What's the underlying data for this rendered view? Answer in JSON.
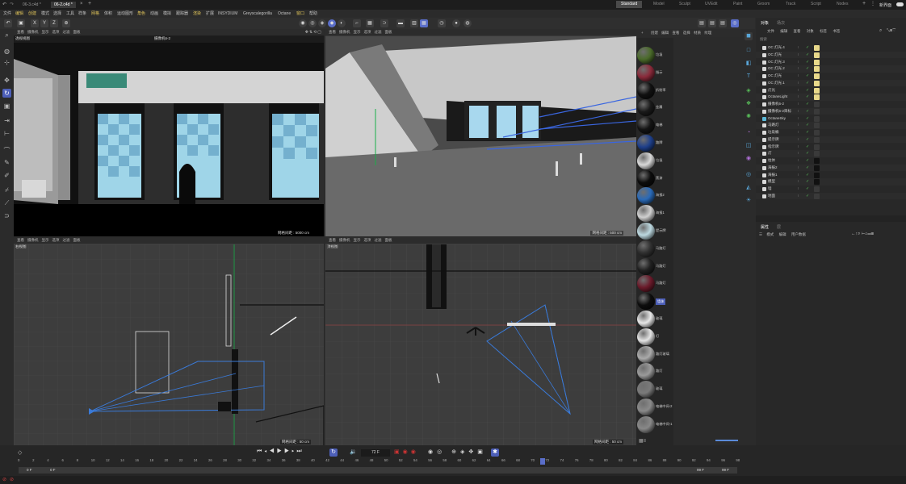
{
  "titlebar": {
    "tabs": [
      {
        "label": "06-3.c4d *"
      },
      {
        "label": "06-2.c4d *"
      }
    ],
    "layouts": [
      "Standard",
      "Model",
      "Sculpt",
      "UVEdit",
      "Paint",
      "Groom",
      "Track",
      "Script",
      "Nodes"
    ],
    "new_layout": "新界面"
  },
  "menubar": {
    "items": [
      "文件",
      "编辑",
      "创建",
      "模式",
      "选择",
      "工具",
      "样条",
      "网格",
      "体积",
      "运动图形",
      "角色",
      "动画",
      "模拟",
      "跟踪器",
      "渲染",
      "扩展",
      "INSYDIUM",
      "Greyscalegorilla",
      "Octane",
      "窗口",
      "帮助"
    ]
  },
  "toolbar": {
    "axis_x": "X",
    "axis_y": "Y",
    "axis_z": "Z"
  },
  "viewports": {
    "menu": [
      "查看",
      "摄像机",
      "显示",
      "选项",
      "过滤",
      "面板"
    ],
    "tl": {
      "label": "透视视图",
      "camera": "摄像机6-2",
      "footer": "网格间距 : 5000 cm"
    },
    "tr": {
      "label": "透视视图",
      "footer": "网格间距 : 500 cm"
    },
    "bl": {
      "label": "右视图",
      "footer": "网格间距 : 50 cm"
    },
    "br": {
      "label": "顶视图",
      "footer": "网格间距 : 50 cm"
    }
  },
  "materials": {
    "menu": [
      "+",
      "创建",
      "编辑",
      "查看",
      "选择",
      "材质",
      "纹理"
    ],
    "items": [
      {
        "label": "垃圾",
        "color": "#4a6a2a"
      },
      {
        "label": "指示",
        "color": "#8a2a3a"
      },
      {
        "label": "折射率",
        "color": "#111111"
      },
      {
        "label": "金属",
        "color": "#1a1a1a"
      },
      {
        "label": "电梯",
        "color": "#141414"
      },
      {
        "label": "路牌",
        "color": "#1e3f8a"
      },
      {
        "label": "垃圾",
        "color": "#d8d8d8"
      },
      {
        "label": "黑漆",
        "color": "#0c0c0c"
      },
      {
        "label": "海报2",
        "color": "#2a6ab8"
      },
      {
        "label": "海报1",
        "color": "#d0d0d0"
      },
      {
        "label": "提示牌",
        "color": "#bcd8e0"
      },
      {
        "label": "马路灯",
        "color": "#303030"
      },
      {
        "label": "马路灯",
        "color": "#202020"
      },
      {
        "label": "马路灯",
        "color": "#6a1a2a"
      },
      {
        "label": "墙体",
        "color": "#0e0e0e"
      },
      {
        "label": "玻璃",
        "color": "#e8e8e8"
      },
      {
        "label": "灯",
        "color": "#e4e4e4"
      },
      {
        "label": "路灯玻璃",
        "color": "#aaaaaa"
      },
      {
        "label": "路灯",
        "color": "#9a9a9a"
      },
      {
        "label": "玻璃",
        "color": "#7a7a7a"
      },
      {
        "label": "电梯中间-2",
        "color": "#8a8a8a"
      },
      {
        "label": "电梯中间-1",
        "color": "#888888"
      }
    ]
  },
  "objects_panel": {
    "tabs": [
      "对象",
      "场次"
    ],
    "menu": [
      "文件",
      "编辑",
      "查看",
      "对象",
      "标签",
      "书签"
    ],
    "search_placeholder": "搜索",
    "items": [
      {
        "name": "OC 灯光.4",
        "color": "#d8d8d8"
      },
      {
        "name": "OC 灯光",
        "color": "#d8d8d8"
      },
      {
        "name": "OC 灯光.3",
        "color": "#d8d8d8"
      },
      {
        "name": "OC 灯光.2",
        "color": "#d8d8d8"
      },
      {
        "name": "OC 灯光",
        "color": "#d8d8d8"
      },
      {
        "name": "OC 灯光.1",
        "color": "#d8d8d8"
      },
      {
        "name": "灯光",
        "color": "#d8d8d8"
      },
      {
        "name": "OctaneLight",
        "color": "#d8d8d8"
      },
      {
        "name": "摄像机6-2",
        "color": "#d8d8d8"
      },
      {
        "name": "摄像机6-2目标",
        "color": "#d8d8d8"
      },
      {
        "name": "OctaneSky",
        "color": "#5ab8d8"
      },
      {
        "name": "马路灯",
        "color": "#d8d8d8"
      },
      {
        "name": "垃圾桶",
        "color": "#d8d8d8"
      },
      {
        "name": "提示牌",
        "color": "#d8d8d8"
      },
      {
        "name": "指示牌",
        "color": "#d8d8d8"
      },
      {
        "name": "灯",
        "color": "#d8d8d8"
      },
      {
        "name": "柱体",
        "color": "#d8d8d8"
      },
      {
        "name": "海报2",
        "color": "#d8d8d8"
      },
      {
        "name": "海报1",
        "color": "#d8d8d8"
      },
      {
        "name": "模型",
        "color": "#d8d8d8"
      },
      {
        "name": "墙",
        "color": "#d8d8d8"
      },
      {
        "name": "地面",
        "color": "#d8d8d8"
      }
    ]
  },
  "attributes_panel": {
    "tabs": [
      "属性",
      "层"
    ],
    "menu": [
      "模式",
      "编辑",
      "用户数据"
    ]
  },
  "timeline": {
    "frame_field": "72 F",
    "ruler": [
      "0",
      "2",
      "4",
      "6",
      "8",
      "10",
      "12",
      "14",
      "16",
      "18",
      "20",
      "22",
      "24",
      "26",
      "28",
      "30",
      "32",
      "34",
      "36",
      "38",
      "40",
      "42",
      "44",
      "46",
      "48",
      "50",
      "52",
      "54",
      "56",
      "58",
      "60",
      "62",
      "64",
      "66",
      "68",
      "70",
      "72",
      "74",
      "76",
      "78",
      "80",
      "82",
      "84",
      "86",
      "88",
      "90",
      "92",
      "94",
      "96",
      "98"
    ],
    "start_a": "0 F",
    "start_b": "0 F",
    "end_a": "99 F",
    "end_b": "99 F"
  }
}
